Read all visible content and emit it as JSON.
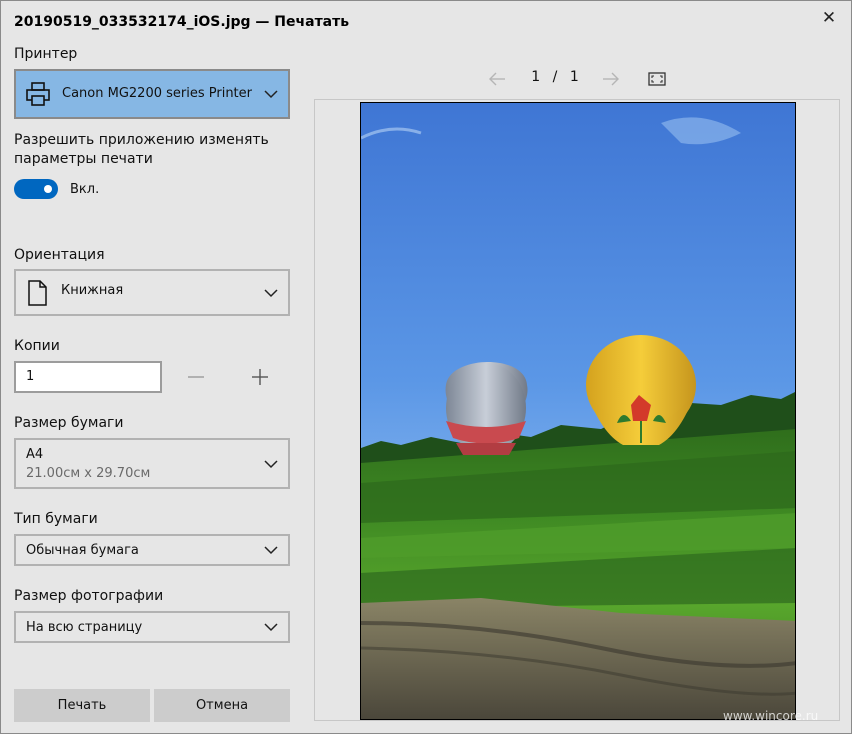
{
  "window": {
    "title": "20190519_033532174_iOS.jpg — Печатать",
    "close_glyph": "✕"
  },
  "printer": {
    "label": "Принтер",
    "value": "Canon MG2200 series Printer",
    "icon": "printer-icon"
  },
  "allow_app": {
    "label_line1": "Разрешить приложению изменять",
    "label_line2": "параметры печати",
    "toggle_state": "Вкл."
  },
  "orientation": {
    "label": "Ориентация",
    "value": "Книжная",
    "icon": "page-icon"
  },
  "copies": {
    "label": "Копии",
    "value": "1"
  },
  "paper_size": {
    "label": "Размер бумаги",
    "value": "A4",
    "detail": "21.00см x 29.70см"
  },
  "paper_type": {
    "label": "Тип бумаги",
    "value": "Обычная бумага"
  },
  "photo_size": {
    "label": "Размер фотографии",
    "value": "На всю страницу"
  },
  "buttons": {
    "print": "Печать",
    "cancel": "Отмена"
  },
  "preview": {
    "current_page": "1",
    "separator": "/",
    "total_pages": "1"
  },
  "watermark": "www.wincore.ru",
  "colors": {
    "accent": "#0067c0",
    "printer_selected": "#86b7e4",
    "background": "#e6e6e6"
  }
}
